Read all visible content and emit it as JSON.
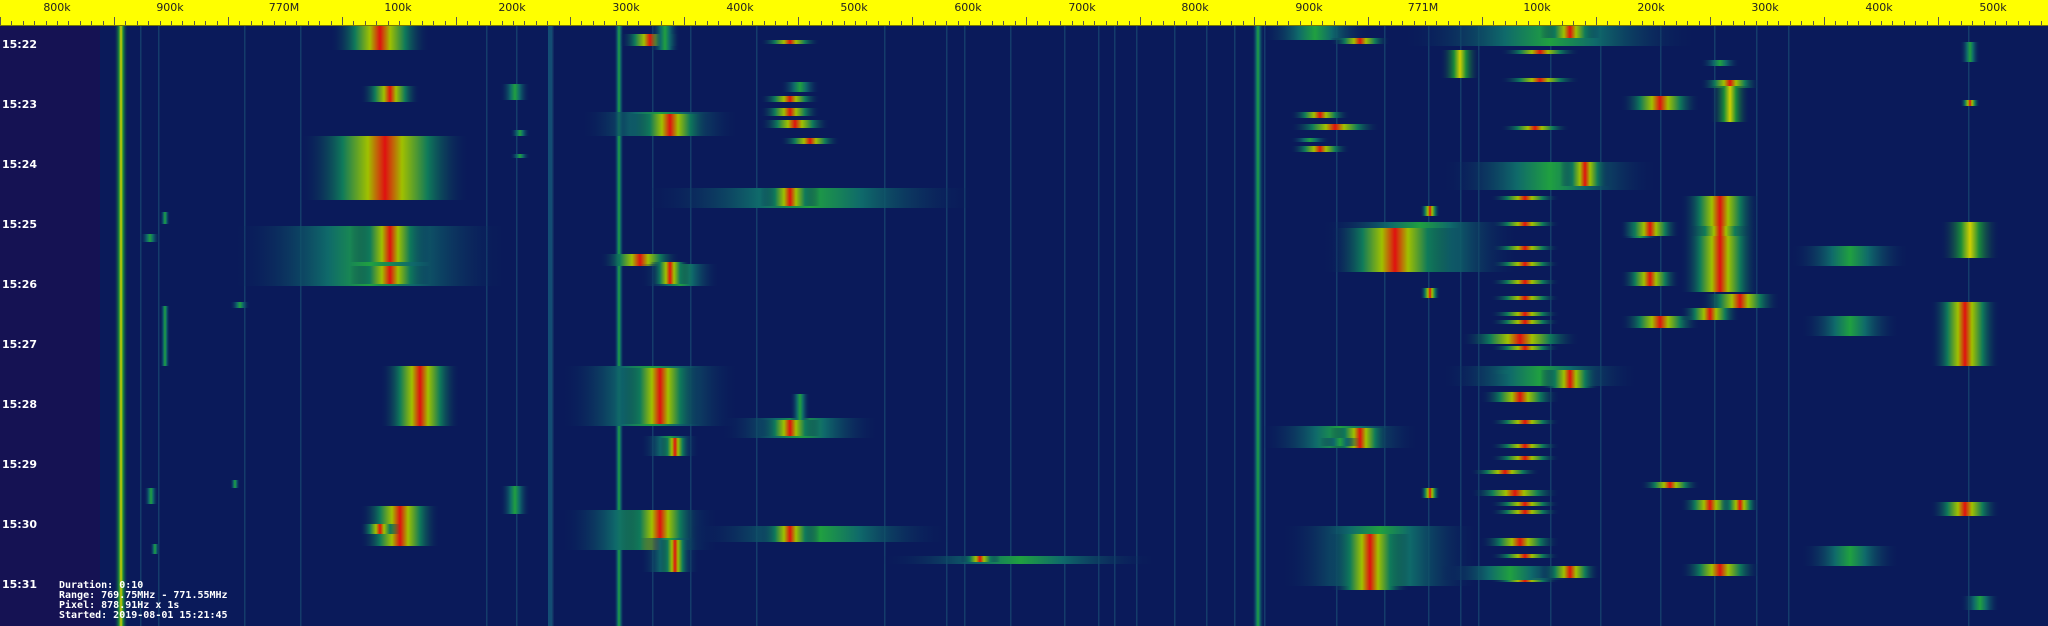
{
  "frequency_axis": {
    "ticks": [
      "800k",
      "900k",
      "770M",
      "100k",
      "200k",
      "300k",
      "400k",
      "500k",
      "600k",
      "700k",
      "800k",
      "900k",
      "771M",
      "100k",
      "200k",
      "300k",
      "400k",
      "500k"
    ]
  },
  "time_axis": {
    "labels": [
      "15:22",
      "15:23",
      "15:24",
      "15:25",
      "15:26",
      "15:27",
      "15:28",
      "15:29",
      "15:30",
      "15:31"
    ]
  },
  "info": {
    "duration": "Duration: 0:10",
    "range": "Range: 769.75MHz - 771.55MHz",
    "pixel": "Pixel: 878.91Hz x 1s",
    "started": "Started: 2019-08-01 15:21:45"
  },
  "colors": {
    "background": "#0a1a5a",
    "ruler": "#ffff00",
    "signal_low": "#1a8a3a",
    "signal_mid": "#c8c800",
    "signal_high": "#e01010"
  }
}
